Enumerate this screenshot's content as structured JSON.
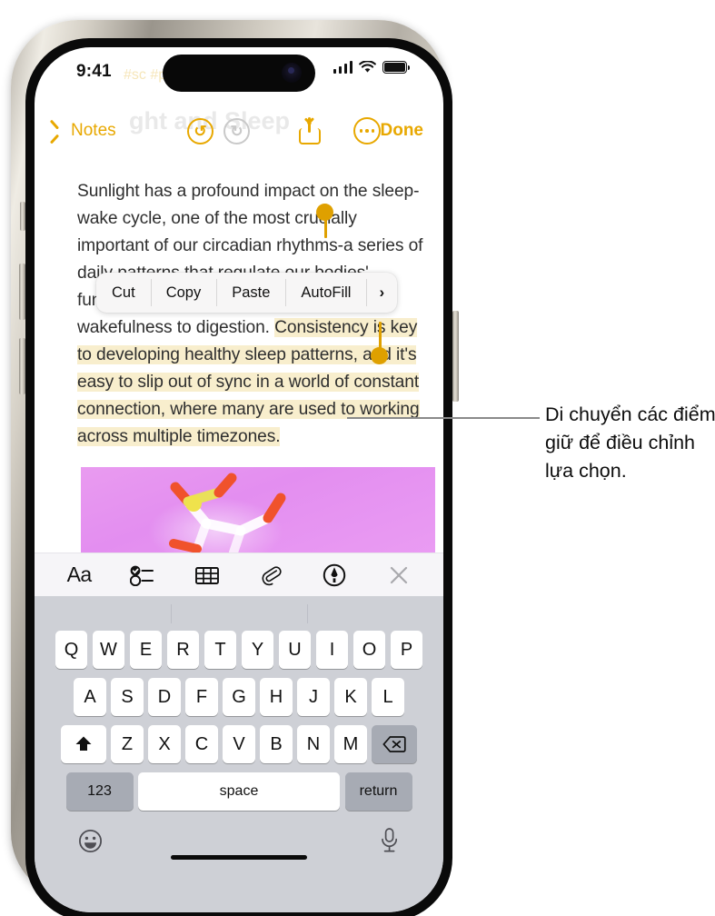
{
  "status_bar": {
    "time": "9:41",
    "cellular_icon": "signal-bars-icon",
    "wifi_icon": "wifi-icon",
    "battery_icon": "battery-icon"
  },
  "ghost_content": {
    "tags": "#sc  #psy",
    "title": "ght and Sleep"
  },
  "nav_bar": {
    "back_label": "Notes",
    "back_icon": "chevron-left-icon",
    "undo_icon": "undo-arrow-icon",
    "undo_glyph": "↺",
    "redo_icon": "redo-arrow-icon",
    "redo_glyph": "↻",
    "share_icon": "share-icon",
    "more_icon": "more-ellipsis-icon",
    "done_label": "Done",
    "accent_color": "#e8a800"
  },
  "note": {
    "paragraph_before": "Sunlight has a profound impact on the sleep-wake cycle, one of the most crucially important of our circadian rhythms-a series of daily patterns that regulate our bodies' functions to optimize everything from wakefulness to digestion. ",
    "selected_text": "Consistency is key to developing healthy sleep patterns, and it's easy to slip out of sync in a world of constant connection, where many are used to working across multiple timezones.",
    "selection_highlight_color": "#f8eecd",
    "handle_color": "#dfa000",
    "attachment_name": "molecule-image",
    "attachment_bg_color": "#e99bf0"
  },
  "context_menu": {
    "items": [
      {
        "label": "Cut",
        "name": "cut"
      },
      {
        "label": "Copy",
        "name": "copy"
      },
      {
        "label": "Paste",
        "name": "paste"
      },
      {
        "label": "AutoFill",
        "name": "autofill"
      }
    ],
    "more_glyph": "›",
    "more_name": "more-actions"
  },
  "format_toolbar": {
    "buttons": [
      {
        "label": "Aa",
        "name": "text-format-icon"
      },
      {
        "label": "",
        "name": "checklist-icon"
      },
      {
        "label": "",
        "name": "table-icon"
      },
      {
        "label": "",
        "name": "attachment-paperclip-icon"
      },
      {
        "label": "",
        "name": "markup-pen-icon"
      },
      {
        "label": "",
        "name": "close-icon"
      }
    ]
  },
  "keyboard": {
    "row1": [
      "Q",
      "W",
      "E",
      "R",
      "T",
      "Y",
      "U",
      "I",
      "O",
      "P"
    ],
    "row2": [
      "A",
      "S",
      "D",
      "F",
      "G",
      "H",
      "J",
      "K",
      "L"
    ],
    "row3": [
      "Z",
      "X",
      "C",
      "V",
      "B",
      "N",
      "M"
    ],
    "shift_icon": "shift-arrow-icon",
    "delete_icon": "delete-backspace-icon",
    "numbers_label": "123",
    "space_label": "space",
    "return_label": "return",
    "emoji_icon": "emoji-smiley-icon",
    "dictation_icon": "microphone-icon"
  },
  "callout": {
    "text": "Di chuyển các điểm giữ để điều chỉnh lựa chọn."
  }
}
